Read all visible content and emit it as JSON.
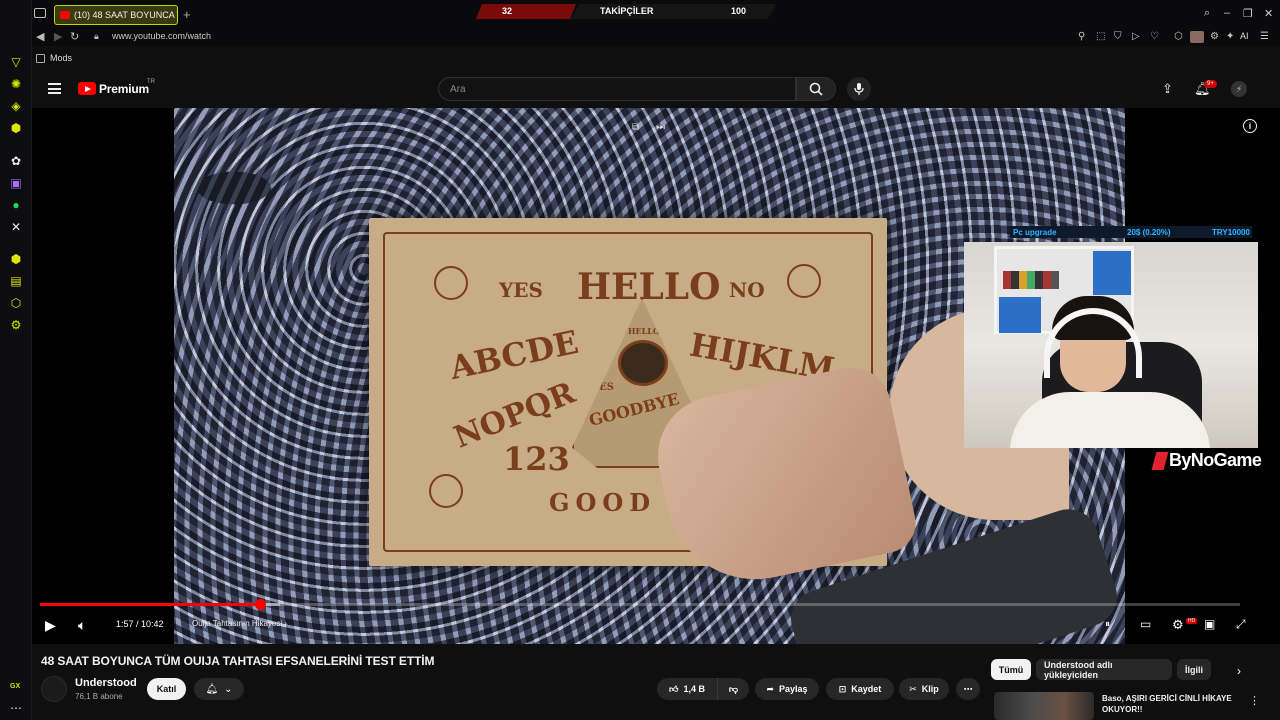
{
  "browser": {
    "tab_title": "(10) 48 SAAT BOYUNCA T...",
    "url": "www.youtube.com/watch",
    "bookmark_folder": "Mods",
    "ai_label": "AI",
    "gx_corner": "GX"
  },
  "stream_overlay": {
    "follow_current": "32",
    "follow_label": "TAKİPÇİLER",
    "follow_goal": "100",
    "upgrade_label": "Pc upgrade",
    "upgrade_progress": "20$ (0.20%)",
    "upgrade_goal": "TRY10000",
    "streamer_logo": "ByNoGame"
  },
  "youtube": {
    "brand": "Premium",
    "country": "TR",
    "search_placeholder": "Ara",
    "notifications_badge": "9+"
  },
  "player": {
    "time": "1:57 / 10:42",
    "chapter": "Ouija Tahtasının Hikayesi",
    "progress_played_fraction": 0.183,
    "progress_buffered_fraction": 0.2,
    "board": {
      "yes": "YES",
      "hello": "HELLO",
      "no": "NO",
      "row1": "ABCDE",
      "row1b": "HIJKLM",
      "row2": "NOPQR",
      "planchette_top": "HELLO",
      "planchette_yes": "YES",
      "planchette_goodbye": "GOODBYE",
      "numbers": "123",
      "bottom": "GOOD B"
    }
  },
  "video": {
    "title": "48 SAAT BOYUNCA TÜM OUIJA TAHTASI EFSANELERİNİ TEST ETTİM",
    "channel": "Understood",
    "subscribers": "76,1 B abone",
    "join_label": "Katıl",
    "like_count": "1,4 B",
    "share_label": "Paylaş",
    "save_label": "Kaydet",
    "clip_label": "Klip"
  },
  "sidebar_chips": {
    "all": "Tümü",
    "uploader": "Understood adlı yükleyiciden",
    "related": "İlgili"
  },
  "recommendation": {
    "title": "Baso, AŞIRI GERİCİ CİNLİ HİKAYE OKUYOR!!"
  },
  "colors": {
    "accent_gx": "#d8e600",
    "youtube_red": "#ff0000",
    "follow_red": "#7a0b0b",
    "overlay_blue": "#2db5ff"
  }
}
